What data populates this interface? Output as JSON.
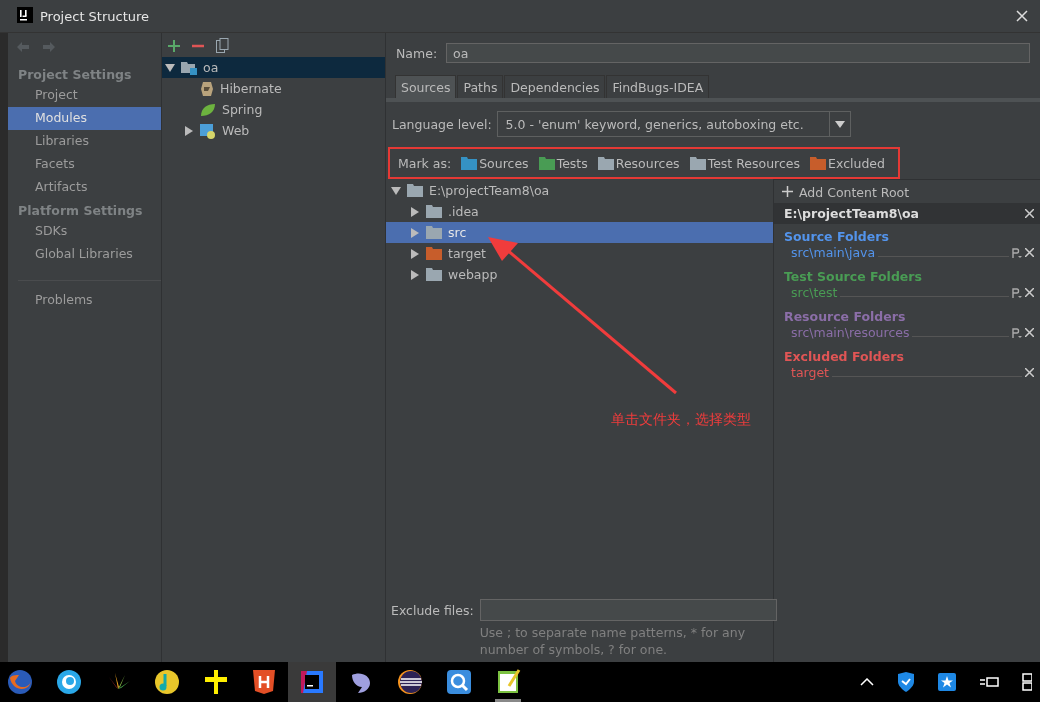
{
  "window": {
    "title": "Project Structure"
  },
  "nav": {
    "sections": [
      {
        "title": "Project Settings",
        "items": [
          {
            "label": "Project",
            "selected": false
          },
          {
            "label": "Modules",
            "selected": true
          },
          {
            "label": "Libraries",
            "selected": false
          },
          {
            "label": "Facets",
            "selected": false
          },
          {
            "label": "Artifacts",
            "selected": false
          }
        ]
      },
      {
        "title": "Platform Settings",
        "items": [
          {
            "label": "SDKs",
            "selected": false
          },
          {
            "label": "Global Libraries",
            "selected": false
          }
        ]
      }
    ],
    "problems": {
      "label": "Problems",
      "selected": false
    }
  },
  "module_tree": [
    {
      "label": "oa",
      "expanded": true,
      "selected": true,
      "children": [
        {
          "label": "Hibernate",
          "kind": "hibernate",
          "selected": false
        },
        {
          "label": "Spring",
          "kind": "spring",
          "selected": false
        },
        {
          "label": "Web",
          "kind": "web",
          "expanded": false,
          "selected": false
        }
      ]
    }
  ],
  "name_field": {
    "label": "Name:",
    "value": "oa"
  },
  "tabs": [
    {
      "label": "Sources",
      "selected": true
    },
    {
      "label": "Paths",
      "selected": false
    },
    {
      "label": "Dependencies",
      "selected": false
    },
    {
      "label": "FindBugs-IDEA",
      "selected": false
    }
  ],
  "language_level": {
    "label": "Language level:",
    "value": "5.0 - 'enum' keyword, generics, autoboxing etc."
  },
  "mark_as": {
    "label": "Mark as:",
    "options": [
      {
        "label": "Sources",
        "color": "#3592c4"
      },
      {
        "label": "Tests",
        "color": "#499c54"
      },
      {
        "label": "Resources",
        "color": "#9aa7b0"
      },
      {
        "label": "Test Resources",
        "color": "#9aa7b0"
      },
      {
        "label": "Excluded",
        "color": "#c75d2b"
      }
    ]
  },
  "folder_tree": {
    "label": "E:\\projectTeam8\\oa",
    "expanded": true,
    "children": [
      {
        "label": ".idea",
        "color": "#9aa7b0",
        "selected": false
      },
      {
        "label": "src",
        "color": "#9aa7b0",
        "selected": true
      },
      {
        "label": "target",
        "color": "#c75d2b",
        "selected": false
      },
      {
        "label": "webapp",
        "color": "#9aa7b0",
        "selected": false
      }
    ]
  },
  "content_root": {
    "add_label": "Add Content Root",
    "path": "E:\\projectTeam8\\oa",
    "groups": [
      {
        "title": "Source Folders",
        "color": "#5394ec",
        "paths": [
          {
            "path": "src\\main\\java",
            "prefix": true
          }
        ]
      },
      {
        "title": "Test Source Folders",
        "color": "#499c54",
        "paths": [
          {
            "path": "src\\test",
            "prefix": true
          }
        ]
      },
      {
        "title": "Resource Folders",
        "color": "#8b6ea8",
        "paths": [
          {
            "path": "src\\main\\resources",
            "prefix": true
          }
        ]
      },
      {
        "title": "Excluded Folders",
        "color": "#e05555",
        "paths": [
          {
            "path": "target",
            "prefix": false
          }
        ]
      }
    ]
  },
  "exclude_files": {
    "label": "Exclude files:",
    "hint": "Use ; to separate name patterns, * for any number of symbols, ? for one."
  },
  "annotation": {
    "text": "单击文件夹，选择类型"
  }
}
